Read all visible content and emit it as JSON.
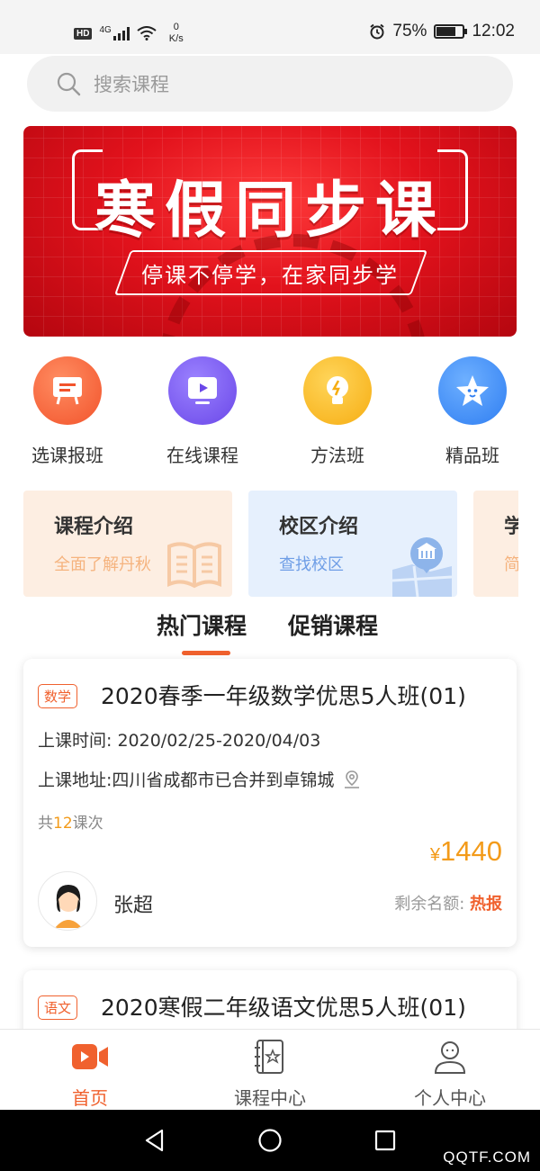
{
  "status_bar": {
    "hd": "HD",
    "network": "4G",
    "speed_value": "0",
    "speed_unit": "K/s",
    "battery": "75%",
    "battery_level": 0.75,
    "time": "12:02"
  },
  "search": {
    "placeholder": "搜索课程",
    "icon": "search-icon"
  },
  "banner": {
    "title": "寒假同步课",
    "subtitle": "停课不停学，在家同步学"
  },
  "quick_actions": [
    {
      "label": "选课报班",
      "icon": "chat-board-icon",
      "color": "#f7663d"
    },
    {
      "label": "在线课程",
      "icon": "monitor-play-icon",
      "color": "#7a5cf0"
    },
    {
      "label": "方法班",
      "icon": "lightbulb-icon",
      "color": "#f9bb22"
    },
    {
      "label": "精品班",
      "icon": "star-icon",
      "color": "#3f8ef5"
    }
  ],
  "intro_cards": [
    {
      "title": "课程介绍",
      "subtitle": "全面了解丹秋",
      "bg": "#fdeee2",
      "sub_color": "#f5b37e",
      "icon": "book-icon"
    },
    {
      "title": "校区介绍",
      "subtitle": "查找校区",
      "bg": "#e6f0fd",
      "sub_color": "#6f9ee6",
      "icon": "map-building-icon"
    },
    {
      "title": "学",
      "subtitle": "简",
      "bg": "#fdeee2",
      "sub_color": "#f5b37e",
      "icon": ""
    }
  ],
  "tabs": [
    {
      "label": "热门课程",
      "active": true
    },
    {
      "label": "促销课程",
      "active": false
    }
  ],
  "courses": [
    {
      "tag": "数学",
      "title": "2020春季一年级数学优思5人班(01)",
      "time_label": "上课时间: ",
      "time": "2020/02/25-2020/04/03",
      "address_label": "上课地址: ",
      "address": "四川省成都市已合并到卓锦城",
      "count_prefix": "共",
      "count": "12",
      "count_suffix": "课次",
      "price_symbol": "¥",
      "price": "1440",
      "teacher": "张超",
      "remain_label": "剩余名额: ",
      "remain": "热报"
    },
    {
      "tag": "语文",
      "title": "2020寒假二年级语文优思5人班(01)"
    }
  ],
  "bottom_nav": [
    {
      "label": "首页",
      "icon": "video-camera-icon",
      "active": true
    },
    {
      "label": "课程中心",
      "icon": "course-book-icon",
      "active": false
    },
    {
      "label": "个人中心",
      "icon": "user-icon",
      "active": false
    }
  ],
  "watermark": "QQTF.COM",
  "colors": {
    "accent": "#f0612e",
    "price": "#f39b1a"
  }
}
